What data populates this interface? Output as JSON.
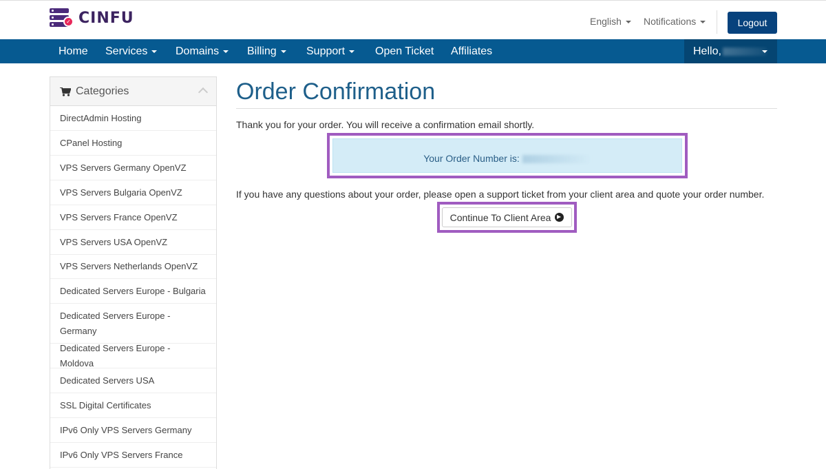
{
  "brand": {
    "name": "CINFU"
  },
  "header": {
    "language": "English",
    "notifications": "Notifications",
    "logout_label": "Logout"
  },
  "nav": {
    "items": [
      {
        "label": "Home"
      },
      {
        "label": "Services"
      },
      {
        "label": "Domains"
      },
      {
        "label": "Billing"
      },
      {
        "label": "Support"
      },
      {
        "label": "Open Ticket"
      },
      {
        "label": "Affiliates"
      }
    ],
    "user_greeting": "Hello,"
  },
  "sidebar": {
    "title": "Categories",
    "items": [
      {
        "label": "DirectAdmin Hosting"
      },
      {
        "label": "CPanel Hosting"
      },
      {
        "label": "VPS Servers Germany OpenVZ"
      },
      {
        "label": "VPS Servers Bulgaria OpenVZ"
      },
      {
        "label": "VPS Servers France OpenVZ"
      },
      {
        "label": "VPS Servers USA OpenVZ"
      },
      {
        "label": "VPS Servers Netherlands OpenVZ"
      },
      {
        "label": "Dedicated Servers Europe - Bulgaria"
      },
      {
        "label": "Dedicated Servers Europe - Germany"
      },
      {
        "label": "Dedicated Servers Europe - Moldova"
      },
      {
        "label": "Dedicated Servers USA"
      },
      {
        "label": "SSL Digital Certificates"
      },
      {
        "label": "IPv6 Only VPS Servers Germany"
      },
      {
        "label": "IPv6 Only VPS Servers France"
      }
    ]
  },
  "main": {
    "title": "Order Confirmation",
    "thanks": "Thank you for your order. You will receive a confirmation email shortly.",
    "order_number_label": "Your Order Number is:",
    "question": "If you have any questions about your order, please open a support ticket from your client area and quote your order number.",
    "continue_label": "Continue To Client Area"
  },
  "colors": {
    "nav_bg": "#065a91",
    "logout_bg": "#07427d",
    "highlight": "#a05cc0",
    "alert_bg": "#d4ecf7",
    "title": "#1e5f8a"
  }
}
